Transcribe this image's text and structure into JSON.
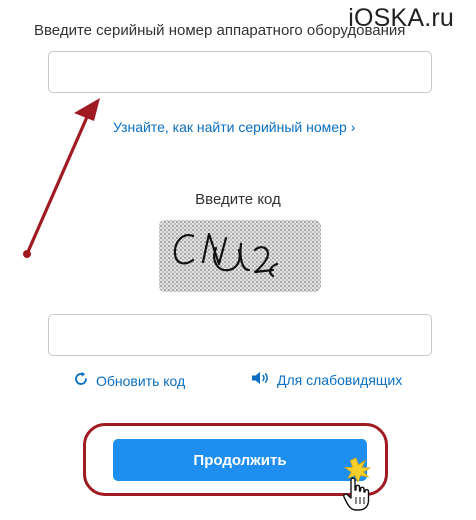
{
  "watermark": "iOSKA.ru",
  "serial": {
    "label": "Введите серийный номер аппаратного оборудования",
    "value": "",
    "find_link": "Узнайте, как найти серийный номер ›"
  },
  "code": {
    "label": "Введите код",
    "captcha_text": "CNU2",
    "value": ""
  },
  "actions": {
    "refresh_label": "Обновить код",
    "audio_label": "Для слабовидящих",
    "continue_label": "Продолжить"
  },
  "colors": {
    "link": "#0a6fc2",
    "button": "#1e8ff0",
    "annotation": "#a01a22"
  },
  "icons": [
    "refresh-icon",
    "speaker-icon",
    "hand-pointer-icon",
    "click-burst-icon"
  ]
}
